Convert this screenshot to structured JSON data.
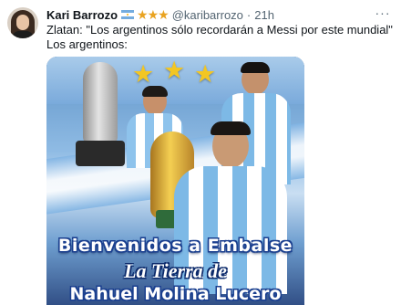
{
  "tweet": {
    "author": {
      "display_name": "Kari Barrozo",
      "badges": {
        "flag": "argentina-flag-emoji",
        "stars": "★★★"
      },
      "handle": "@karibarrozo",
      "separator": "·",
      "time": "21h"
    },
    "more_icon": "···",
    "text_lines": [
      "Zlatan: \"Los argentinos sólo recordarán a Messi por este mundial\"",
      "Los argentinos:"
    ],
    "media": {
      "overlay_lines": [
        "Bienvenidos a Embalse",
        "La Tierra de",
        "Nahuel Molina Lucero"
      ],
      "stars": [
        "★",
        "★",
        "★"
      ],
      "colors": {
        "sky_blue": "#74acdf",
        "star_gold": "#f3c623",
        "text_outline": "#1a3f8f"
      }
    }
  }
}
